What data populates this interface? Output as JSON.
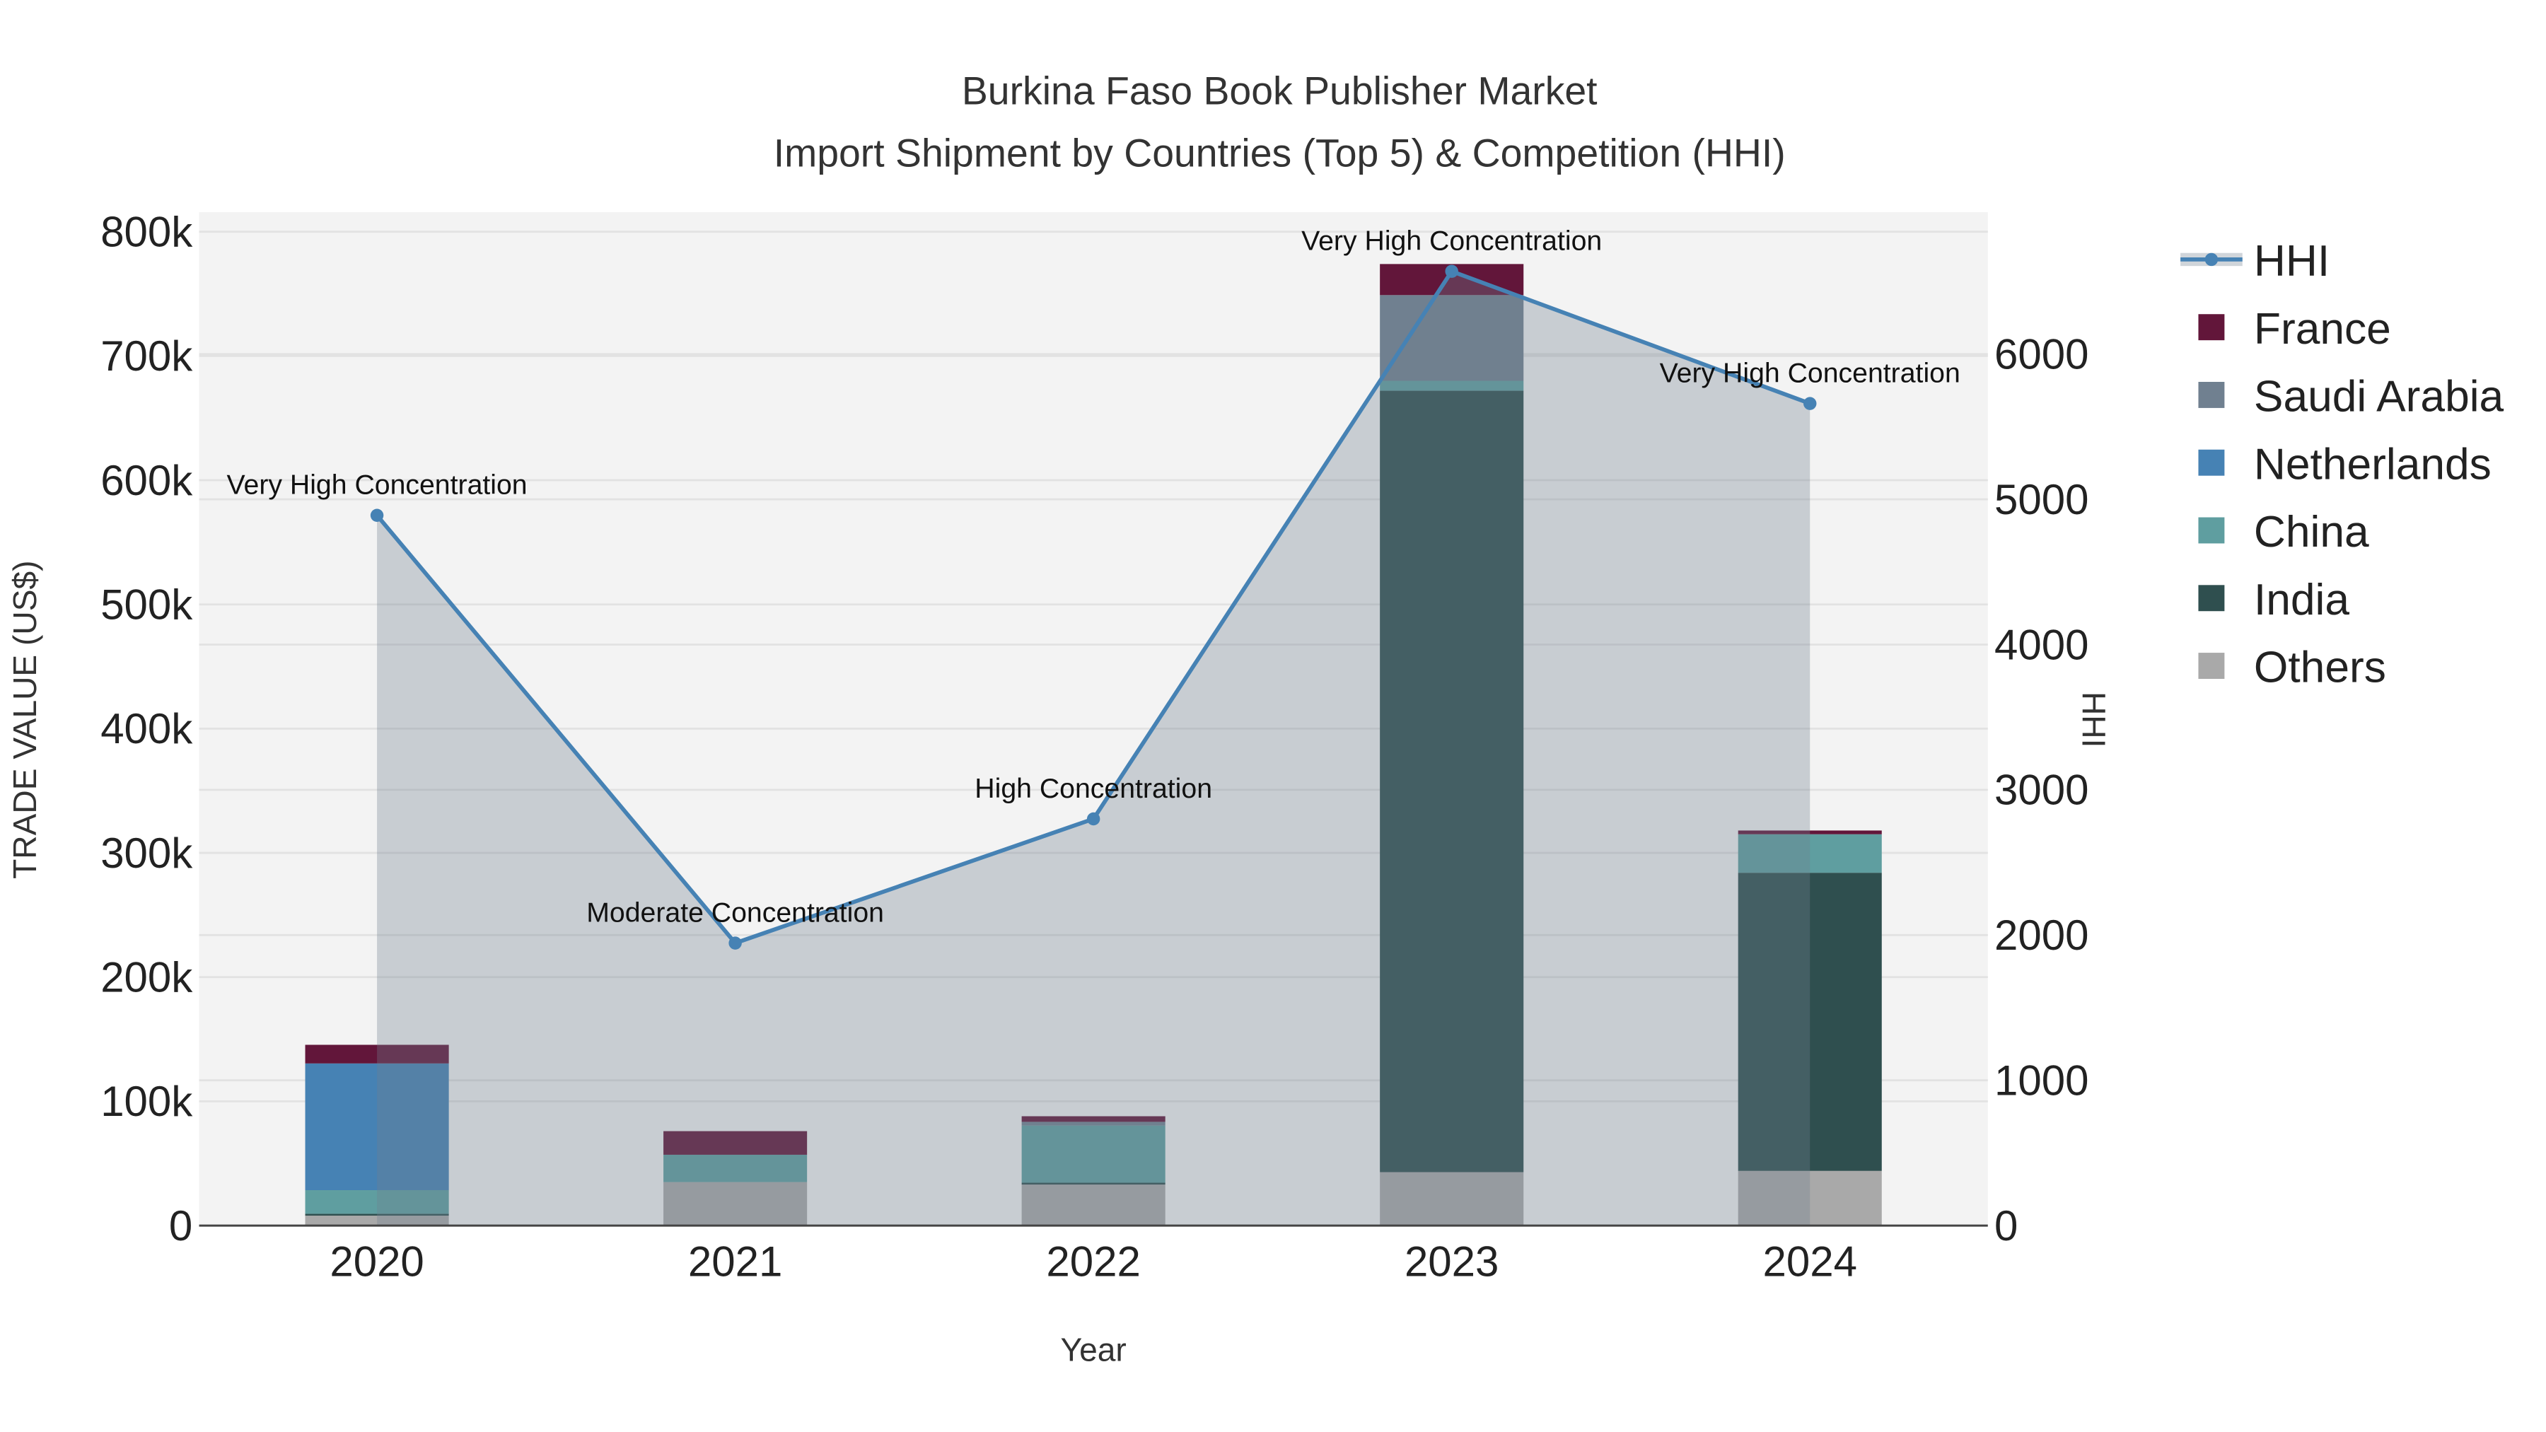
{
  "chart_data": {
    "type": "bar",
    "title": "Burkina Faso Book Publisher Market",
    "subtitle": "Import Shipment by Countries (Top 5) & Competition (HHI)",
    "xlabel": "Year",
    "ylabel": "TRADE VALUE (US$)",
    "y2label": "HHI",
    "categories": [
      "2020",
      "2021",
      "2022",
      "2023",
      "2024"
    ],
    "ylim": [
      0,
      800000
    ],
    "y2lim": [
      0,
      6850
    ],
    "yticks": [
      {
        "v": 0,
        "label": "0"
      },
      {
        "v": 100000,
        "label": "100k"
      },
      {
        "v": 200000,
        "label": "200k"
      },
      {
        "v": 300000,
        "label": "300k"
      },
      {
        "v": 400000,
        "label": "400k"
      },
      {
        "v": 500000,
        "label": "500k"
      },
      {
        "v": 600000,
        "label": "600k"
      },
      {
        "v": 700000,
        "label": "700k"
      },
      {
        "v": 800000,
        "label": "800k"
      }
    ],
    "y2ticks": [
      {
        "v": 0,
        "label": "0"
      },
      {
        "v": 1000,
        "label": "1000"
      },
      {
        "v": 2000,
        "label": "2000"
      },
      {
        "v": 3000,
        "label": "3000"
      },
      {
        "v": 4000,
        "label": "4000"
      },
      {
        "v": 5000,
        "label": "5000"
      },
      {
        "v": 6000,
        "label": "6000"
      }
    ],
    "grid": true,
    "legend_position": "right",
    "series": [
      {
        "name": "Others",
        "color": "#a9a9a9",
        "values": [
          8000,
          35000,
          33000,
          43000,
          44000
        ]
      },
      {
        "name": "India",
        "color": "#2f4f4f",
        "values": [
          1500,
          0,
          1500,
          629000,
          240000
        ]
      },
      {
        "name": "China",
        "color": "#5f9ea0",
        "values": [
          19000,
          22000,
          46000,
          8000,
          31000
        ]
      },
      {
        "name": "Netherlands",
        "color": "#4682b4",
        "values": [
          102000,
          0,
          0,
          0,
          0
        ]
      },
      {
        "name": "Saudi Arabia",
        "color": "#708090",
        "values": [
          0,
          0,
          3000,
          69000,
          0
        ]
      },
      {
        "name": "France",
        "color": "#62163a",
        "values": [
          15000,
          19000,
          4500,
          25000,
          3000
        ]
      }
    ],
    "hhi": {
      "name": "HHI",
      "color": "#4682b4",
      "values": [
        4890,
        1945,
        2800,
        6570,
        5660
      ],
      "annotations": [
        "Very High Concentration",
        "Moderate Concentration",
        "High Concentration",
        "Very High Concentration",
        "Very High Concentration"
      ]
    },
    "legend": [
      "HHI",
      "France",
      "Saudi Arabia",
      "Netherlands",
      "China",
      "India",
      "Others"
    ]
  }
}
